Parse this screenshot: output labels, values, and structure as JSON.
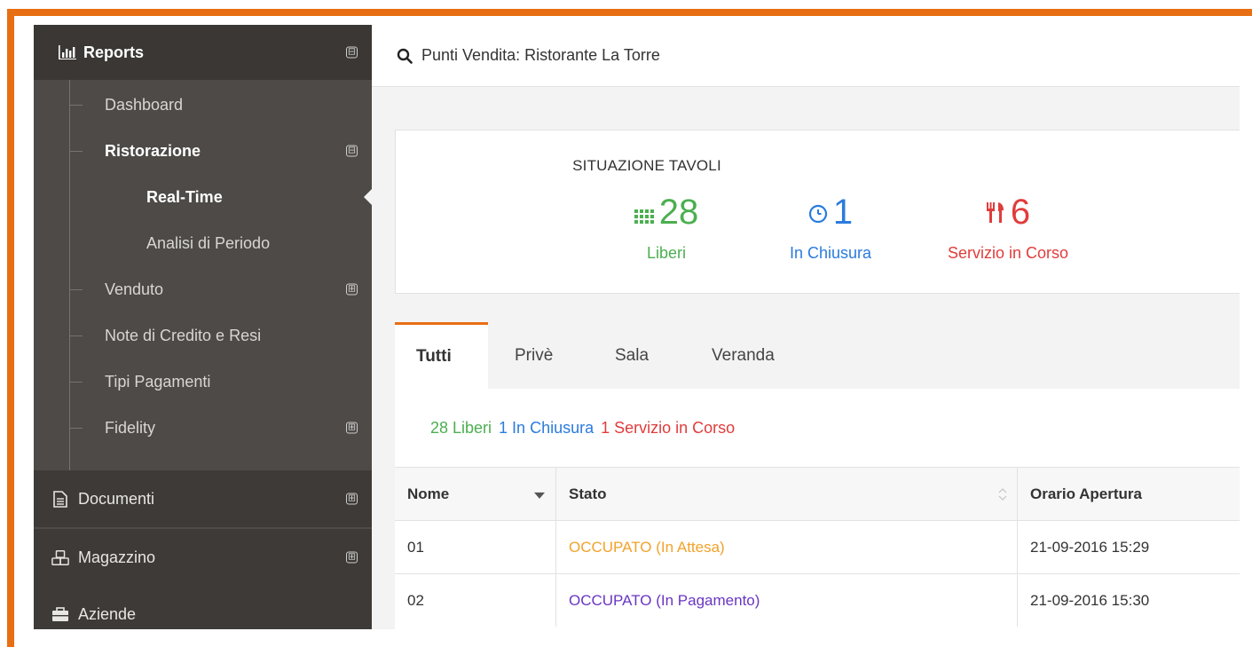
{
  "sidebar": {
    "header_label": "Reports",
    "header_toggle": "⊟",
    "items": [
      {
        "label": "Dashboard"
      },
      {
        "label": "Ristorazione",
        "toggle": "⊟"
      },
      {
        "label": "Real-Time"
      },
      {
        "label": "Analisi di Periodo"
      },
      {
        "label": "Venduto",
        "toggle": "⊞"
      },
      {
        "label": "Note di Credito e Resi"
      },
      {
        "label": "Tipi Pagamenti"
      },
      {
        "label": "Fidelity",
        "toggle": "⊞"
      }
    ],
    "sections": [
      {
        "label": "Documenti",
        "icon": "document-icon",
        "toggle": "⊞"
      },
      {
        "label": "Magazzino",
        "icon": "cubes-icon",
        "toggle": "⊞"
      },
      {
        "label": "Aziende",
        "icon": "briefcase-icon"
      }
    ]
  },
  "topbar": {
    "search_text": "Punti Vendita: Ristorante La Torre"
  },
  "tavoli": {
    "title": "SITUAZIONE TAVOLI",
    "stats": [
      {
        "value": "28",
        "label": "Liberi",
        "icon": "grid-icon",
        "color": "#4caf50"
      },
      {
        "value": "1",
        "label": "In Chiusura",
        "icon": "clock-icon",
        "color": "#2b7bde"
      },
      {
        "value": "6",
        "label": "Servizio in Corso",
        "icon": "cutlery-icon",
        "color": "#e03c3c"
      }
    ]
  },
  "tabs": [
    {
      "label": "Tutti",
      "active": true
    },
    {
      "label": "Privè"
    },
    {
      "label": "Sala"
    },
    {
      "label": "Veranda"
    }
  ],
  "summary": [
    {
      "text": "28 Liberi",
      "color": "#4caf50"
    },
    {
      "text": "1 In Chiusura",
      "color": "#2b7bde"
    },
    {
      "text": "1 Servizio in Corso",
      "color": "#e03c3c"
    }
  ],
  "table": {
    "columns": [
      "Nome",
      "Stato",
      "Orario Apertura"
    ],
    "rows": [
      {
        "nome": "01",
        "stato": "OCCUPATO (In Attesa)",
        "stato_color": "#f2a22a",
        "orario": "21-09-2016 15:29"
      },
      {
        "nome": "02",
        "stato": "OCCUPATO (In Pagamento)",
        "stato_color": "#6a36c2",
        "orario": "21-09-2016 15:30"
      }
    ]
  },
  "colors": {
    "accent": "#e86e13",
    "sidebar": "#4d4a47"
  }
}
